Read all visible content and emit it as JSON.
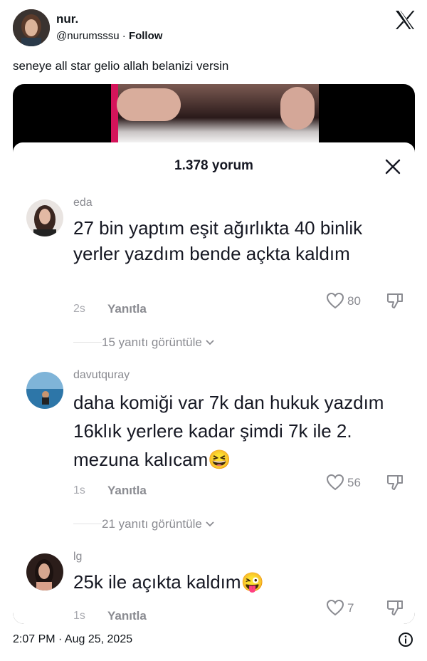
{
  "tweet": {
    "author_name": "nur.",
    "handle": "@nurumsssu",
    "separator": " · ",
    "follow_label": "Follow",
    "text": "seneye all star gelio allah belanizi versin",
    "timestamp": "2:07 PM · Aug 25, 2025",
    "logo_icon": "x-logo-icon",
    "info_icon": "info-icon"
  },
  "sheet": {
    "comment_count": "1.378 yorum",
    "close_icon": "close-icon",
    "reply_label": "Yanıtla"
  },
  "comments": [
    {
      "username": "eda",
      "text": "27 bin yaptım eşit ağırlıkta 40 binlik yerler yazdım bende açkta kaldım",
      "time": "2s",
      "likes": "80",
      "replies": "15 yanıtı görüntüle"
    },
    {
      "username": "davutquray",
      "text": "daha komiği var 7k dan hukuk yazdım 16klık yerlere kadar şimdi 7k ile 2. mezuna kalıcam😆",
      "time": "1s",
      "likes": "56",
      "replies": "21 yanıtı görüntüle"
    },
    {
      "username": "lg",
      "text": "25k ile açıkta kaldım😜",
      "time": "1s",
      "likes": "7"
    }
  ],
  "colors": {
    "text": "#0f1419",
    "muted": "#8a8b91",
    "sheet_bg": "#ffffff",
    "media_bg": "#000000"
  }
}
